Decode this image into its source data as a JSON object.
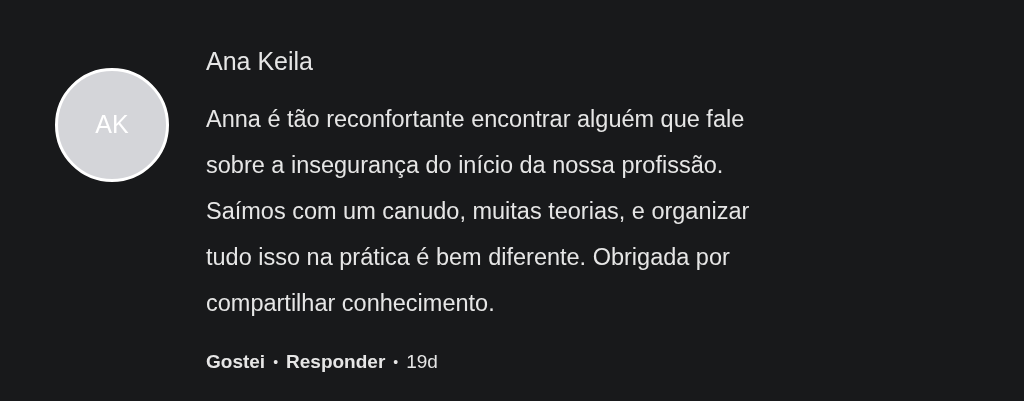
{
  "comment": {
    "avatar_initials": "AK",
    "author": "Ana Keila",
    "text": "Anna é tão reconfortante encontrar alguém que fale sobre a insegurança do início da nossa profissão. Saímos com um canudo, muitas teorias, e organizar tudo isso na prática é bem diferente. Obrigada por compartilhar conhecimento.",
    "actions": [
      {
        "label": "Gostei",
        "kind": "link"
      },
      {
        "label": "•",
        "kind": "separator"
      },
      {
        "label": "Responder",
        "kind": "link"
      },
      {
        "label": "•",
        "kind": "separator"
      },
      {
        "label": "19d",
        "kind": "time"
      }
    ]
  }
}
